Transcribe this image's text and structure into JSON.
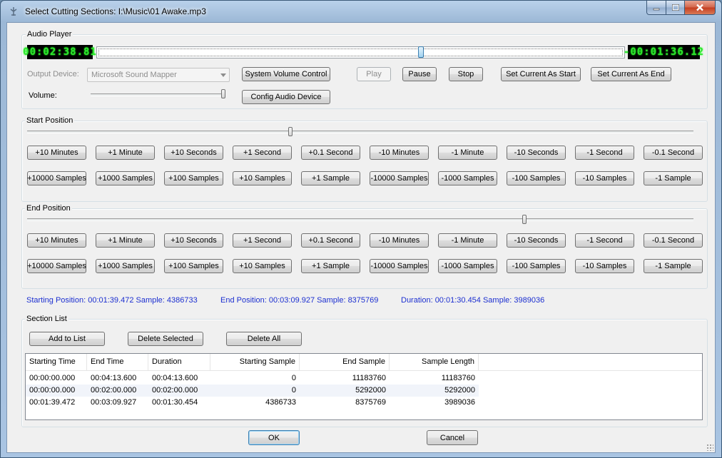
{
  "window": {
    "title": "Select Cutting Sections:  I:\\Music\\01  Awake.mp3"
  },
  "audio_player": {
    "label": "Audio Player",
    "current_time": "00:02:38.81",
    "total_time": "-00:01:36.12",
    "progress_fraction": 0.615,
    "output_device_label": "Output Device:",
    "output_device_value": "Microsoft Sound Mapper",
    "volume_label": "Volume:",
    "volume_fraction": 1.0,
    "buttons": {
      "system_volume": "System Volume Control",
      "config_device": "Config Audio Device",
      "play": "Play",
      "pause": "Pause",
      "stop": "Stop",
      "set_start": "Set Current As Start",
      "set_end": "Set Current As End"
    }
  },
  "start_position": {
    "label": "Start Position",
    "slider_fraction": 0.394
  },
  "end_position": {
    "label": "End Position",
    "slider_fraction": 0.748
  },
  "step_buttons": {
    "row1": [
      "+10 Minutes",
      "+1 Minute",
      "+10 Seconds",
      "+1 Second",
      "+0.1 Second",
      "-10 Minutes",
      "-1 Minute",
      "-10 Seconds",
      "-1 Second",
      "-0.1 Second"
    ],
    "row2": [
      "+10000 Samples",
      "+1000 Samples",
      "+100 Samples",
      "+10 Samples",
      "+1 Sample",
      "-10000 Samples",
      "-1000 Samples",
      "-100 Samples",
      "-10 Samples",
      "-1 Sample"
    ]
  },
  "info": {
    "start": "Starting Position: 00:01:39.472  Sample: 4386733",
    "end": "End Position: 00:03:09.927  Sample: 8375769",
    "duration": "Duration: 00:01:30.454  Sample: 3989036"
  },
  "section_list": {
    "label": "Section List",
    "add_button": "Add to List",
    "delete_selected_button": "Delete Selected",
    "delete_all_button": "Delete All",
    "columns": [
      "Starting Time",
      "End Time",
      "Duration",
      "Starting Sample",
      "End Sample",
      "Sample Length"
    ],
    "rows": [
      [
        "00:00:00.000",
        "00:04:13.600",
        "00:04:13.600",
        "0",
        "11183760",
        "11183760"
      ],
      [
        "00:00:00.000",
        "00:02:00.000",
        "00:02:00.000",
        "0",
        "5292000",
        "5292000"
      ],
      [
        "00:01:39.472",
        "00:03:09.927",
        "00:01:30.454",
        "4386733",
        "8375769",
        "3989036"
      ]
    ]
  },
  "footer": {
    "ok": "OK",
    "cancel": "Cancel"
  },
  "icons": {
    "app": "app-icon",
    "minimize": "minimize-icon",
    "maximize": "maximize-icon",
    "close": "close-icon",
    "dropdown": "chevron-down-icon",
    "size_grip": "size-grip-icon"
  }
}
